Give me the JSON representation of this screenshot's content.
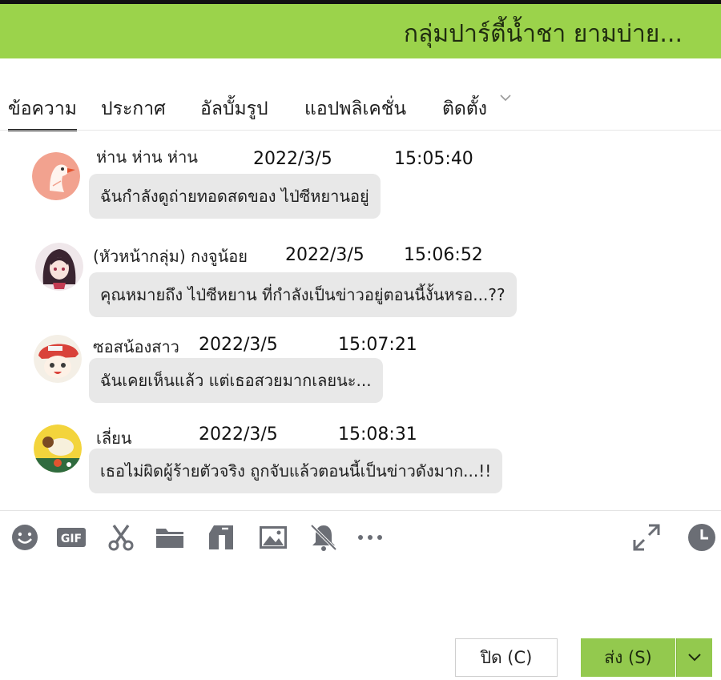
{
  "window": {
    "title": "กลุ่มปาร์ตี้น้ำชา  ยามบ่าย..."
  },
  "tabs": [
    {
      "label": "ข้อความ",
      "active": true
    },
    {
      "label": "ประกาศ",
      "active": false
    },
    {
      "label": "อัลบั้มรูป",
      "active": false
    },
    {
      "label": "แอปพลิเคชั่น",
      "active": false
    },
    {
      "label": "ติดตั้ง",
      "active": false
    }
  ],
  "messages": [
    {
      "sender": "ห่าน ห่าน ห่าน",
      "date": "2022/3/5",
      "time": "15:05:40",
      "text": "ฉันกำลังดูถ่ายทอดสดของ  ไป่ซีหยานอยู่",
      "avatar": "goose-avatar"
    },
    {
      "sender": "(หัวหน้ากลุ่ม) กงจูน้อย",
      "date": "2022/3/5",
      "time": "15:06:52",
      "text": "คุณหมายถึง ไป่ซีหยาน ที่กำลังเป็นข่าวอยู่ตอนนี้งั้นหรอ...??",
      "avatar": "anime-girl-avatar"
    },
    {
      "sender": "ซอสน้องสาว",
      "date": "2022/3/5",
      "time": "15:07:21",
      "text": "ฉันเคยเห็นแล้ว แต่เธอสวยมากเลยนะ...",
      "avatar": "red-hat-girl-avatar"
    },
    {
      "sender": "เลี่ยน",
      "date": "2022/3/5",
      "time": "15:08:31",
      "text": "เธอไม่ผิดผู้ร้ายตัวจริง ถูกจับแล้วตอนนี้เป็นข่าวดังมาก...!!",
      "avatar": "cartoon-animal-avatar"
    }
  ],
  "toolbar": {
    "icons": [
      "emoji-icon",
      "gif-icon",
      "scissors-icon",
      "folder-icon",
      "shake-icon",
      "image-icon",
      "mute-bell-icon",
      "more-icon",
      "expand-icon",
      "history-clock-icon"
    ],
    "gif_label": "GIF"
  },
  "buttons": {
    "close_label": "ปิด (C)",
    "send_label": "ส่ง (S)"
  },
  "colors": {
    "title_bar": "#9bd34b",
    "send_button": "#93c94e",
    "bubble": "#e8e8e8",
    "icon": "#6b6e75"
  }
}
